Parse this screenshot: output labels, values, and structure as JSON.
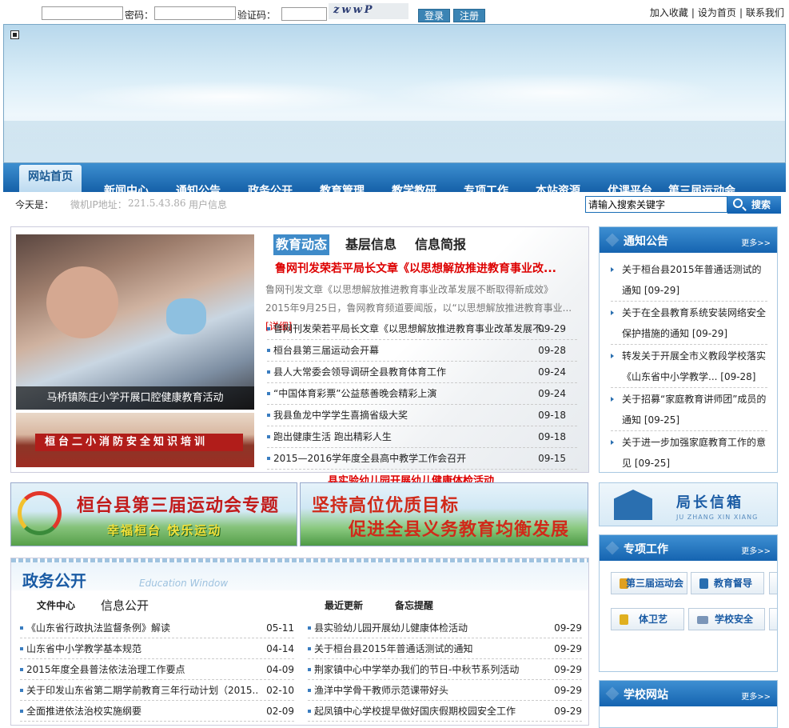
{
  "login": {
    "password_label": "密码：",
    "captcha_label": "验证码：",
    "captcha_text": "zwwP",
    "login_button": "登录",
    "register_button": "注册"
  },
  "toplinks": [
    "加入收藏",
    "|",
    "设为首页",
    "|",
    "联系我们"
  ],
  "nav": {
    "home": "网站首页",
    "items": [
      "新闻中心",
      "通知公告",
      "政务公开",
      "教育管理",
      "教学教研",
      "专项工作",
      "本站资源",
      "优课平台",
      "第三届运动会"
    ]
  },
  "infobar": {
    "today_label": "今天是：",
    "ip_label": "微机IP地址：",
    "ip_value": "221.5.43.86",
    "user_info": "用户信息"
  },
  "search": {
    "value": "请输入搜索关键字",
    "button": "搜索"
  },
  "news": {
    "photo_caption": "马桥镇陈庄小学开展口腔健康教育活动",
    "photo2_sign": "桓台二小消防安全知识培训",
    "tabs": [
      "教育动态",
      "基层信息",
      "信息简报"
    ],
    "headline": "鲁网刊发荣若平局长文章《以思想解放推进教育事业改...",
    "summary": "鲁网刊发文章《以思想解放推进教育事业改革发展不断取得新成效》2015年9月25日，鲁网教育频道要闻版，以“以思想解放推进教育事业...",
    "summary_more": "[详细]",
    "items": [
      {
        "title": "鲁网刊发荣若平局长文章《以思想解放推进教育事业改革发展不...",
        "date": "09-29"
      },
      {
        "title": "桓台县第三届运动会开幕",
        "date": "09-28"
      },
      {
        "title": "县人大常委会领导调研全县教育体育工作",
        "date": "09-24"
      },
      {
        "title": "“中国体育彩票”公益慈善晚会精彩上演",
        "date": "09-24"
      },
      {
        "title": "我县鱼龙中学学生喜摘省级大奖",
        "date": "09-18"
      },
      {
        "title": "跑出健康生活 跑出精彩人生",
        "date": "09-18"
      },
      {
        "title": "2015—2016学年度全县高中教学工作会召开",
        "date": "09-15"
      }
    ],
    "marquee": "县实验幼儿园开展幼儿健康体检活动"
  },
  "banners": {
    "games_title": "桓台县第三届运动会专题",
    "games_slogan": "幸福桓台 快乐运动",
    "edu_line1": "坚持高位优质目标",
    "edu_line2": "促进全县义务教育均衡发展"
  },
  "gov": {
    "title": "政务公开",
    "subtitle": "Education Window",
    "left_tabs": [
      "文件中心",
      "信息公开"
    ],
    "right_tabs": [
      "最近更新",
      "备忘提醒"
    ],
    "left_items": [
      {
        "title": "《山东省行政执法监督条例》解读",
        "date": "05-11"
      },
      {
        "title": "山东省中小学教学基本规范",
        "date": "04-14"
      },
      {
        "title": "2015年度全县普法依法治理工作要点",
        "date": "04-09"
      },
      {
        "title": "关于印发山东省第二期学前教育三年行动计划（2015...",
        "date": "02-10"
      },
      {
        "title": "全面推进依法治校实施纲要",
        "date": "02-09"
      }
    ],
    "right_items": [
      {
        "title": "县实验幼儿园开展幼儿健康体检活动",
        "date": "09-29"
      },
      {
        "title": "关于桓台县2015年普通话测试的通知",
        "date": "09-29"
      },
      {
        "title": "荆家镇中心中学举办我们的节日-中秋节系列活动",
        "date": "09-29"
      },
      {
        "title": "渔洋中学骨干教师示范课带好头",
        "date": "09-29"
      },
      {
        "title": "起凤镇中心学校提早做好国庆假期校园安全工作",
        "date": "09-29"
      }
    ]
  },
  "notice": {
    "title": "通知公告",
    "more": "更多>>",
    "items": [
      "关于桓台县2015年普通话测试的通知 [09-29]",
      "关于在全县教育系统安装网络安全保护措施的通知 [09-29]",
      "转发关于开展全市义教段学校落实《山东省中小学教学... [09-28]",
      "关于招募“家庭教育讲师团”成员的通知 [09-25]",
      "关于进一步加强家庭教育工作的意见 [09-25]"
    ]
  },
  "mailbox": {
    "title": "局长信箱",
    "pinyin": "JU ZHANG XIN XIANG"
  },
  "special": {
    "title": "专项工作",
    "more": "更多>>",
    "buttons": [
      "第三届运动会",
      "教育督导",
      "体卫艺",
      "学校安全"
    ]
  },
  "school": {
    "title": "学校网站",
    "more": "更多>>"
  },
  "colors": {
    "nav_blue": "#1560a8",
    "accent_red": "#dd0000",
    "link_blue": "#1a5ba4"
  }
}
